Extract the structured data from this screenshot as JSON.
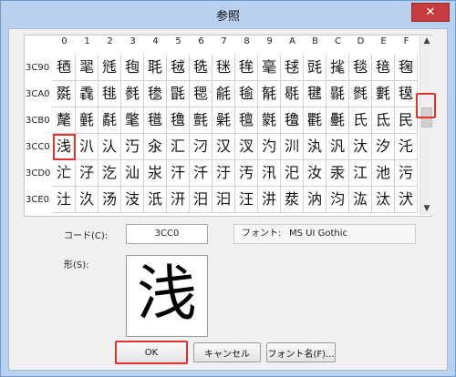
{
  "window": {
    "title": "参照",
    "close_label": "✕"
  },
  "grid": {
    "columns": [
      "0",
      "1",
      "2",
      "3",
      "4",
      "5",
      "6",
      "7",
      "8",
      "9",
      "A",
      "B",
      "C",
      "D",
      "E",
      "F"
    ],
    "rows": [
      {
        "code": "3C90",
        "chars": [
          "毢",
          "毣",
          "毤",
          "毥",
          "毦",
          "毧",
          "毨",
          "毩",
          "毪",
          "毫",
          "毬",
          "毭",
          "毮",
          "毯",
          "毰",
          "毱"
        ]
      },
      {
        "code": "3CA0",
        "chars": [
          "毲",
          "毳",
          "毴",
          "毵",
          "毶",
          "毷",
          "毸",
          "毹",
          "毺",
          "毻",
          "毼",
          "毽",
          "毾",
          "毿",
          "氀",
          "氁"
        ]
      },
      {
        "code": "3CB0",
        "chars": [
          "氂",
          "氃",
          "氄",
          "氅",
          "氆",
          "氇",
          "氈",
          "氉",
          "氊",
          "氋",
          "氌",
          "氍",
          "氎",
          "氏",
          "氐",
          "民"
        ]
      },
      {
        "code": "3CC0",
        "chars": [
          "浅",
          "汃",
          "汄",
          "汅",
          "汆",
          "汇",
          "汈",
          "汉",
          "汊",
          "汋",
          "汌",
          "汍",
          "汎",
          "汏",
          "汐",
          "汑"
        ]
      },
      {
        "code": "3CD0",
        "chars": [
          "汒",
          "汓",
          "汔",
          "汕",
          "汖",
          "汗",
          "汘",
          "汙",
          "汚",
          "汛",
          "汜",
          "汝",
          "汞",
          "江",
          "池",
          "污"
        ]
      },
      {
        "code": "3CE0",
        "chars": [
          "汢",
          "汣",
          "汤",
          "汥",
          "汦",
          "汧",
          "汨",
          "汩",
          "汪",
          "汫",
          "汬",
          "汭",
          "汮",
          "汯",
          "汰",
          "汱"
        ]
      }
    ],
    "selected": "浅"
  },
  "code": {
    "label": "コード(C):",
    "value": "3CC0"
  },
  "font": {
    "label": "フォント:",
    "value": "MS UI Gothic"
  },
  "shape": {
    "label": "形(S):",
    "glyph": "浅"
  },
  "buttons": {
    "ok": "OK",
    "cancel": "キャンセル",
    "font_name": "フォント名(F)..."
  },
  "colors": {
    "highlight": "#e53030",
    "frame": "#b9d1ee"
  }
}
